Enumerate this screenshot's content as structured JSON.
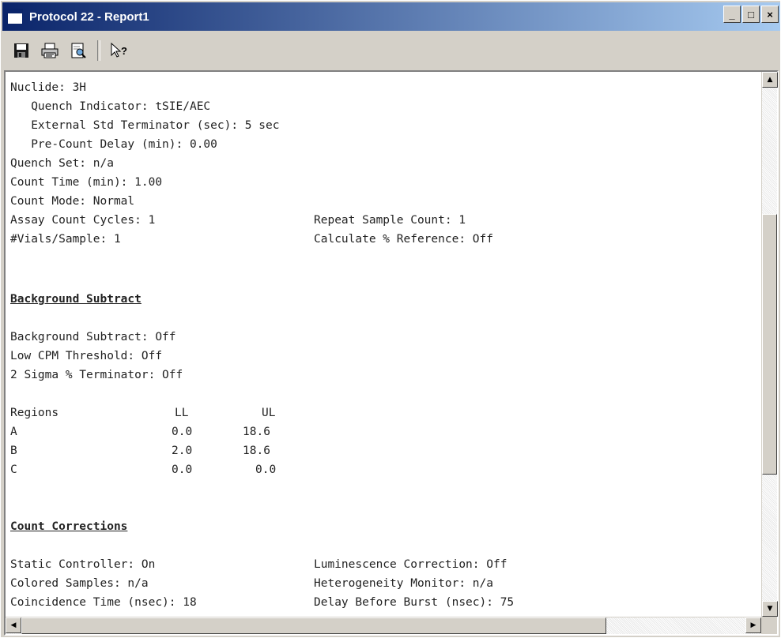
{
  "window": {
    "title": "Protocol 22 - Report1",
    "controls": {
      "minimize": "_",
      "maximize": "□",
      "close": "×"
    }
  },
  "toolbar": {
    "buttons": [
      {
        "name": "save",
        "icon": "floppy-disk-icon"
      },
      {
        "name": "print",
        "icon": "printer-icon"
      },
      {
        "name": "print-preview",
        "icon": "print-preview-icon"
      },
      {
        "name": "context-help",
        "icon": "help-pointer-icon"
      }
    ]
  },
  "report": {
    "nuclide": "Nuclide: 3H",
    "quench_indicator": "   Quench Indicator: tSIE/AEC",
    "ext_std_terminator": "   External Std Terminator (sec): 5 sec",
    "pre_count_delay": "   Pre-Count Delay (min): 0.00",
    "quench_set": "Quench Set: n/a",
    "count_time": "Count Time (min): 1.00",
    "count_mode": "Count Mode: Normal",
    "assay_count_cycles": "Assay Count Cycles: 1",
    "repeat_sample_count": "Repeat Sample Count: 1",
    "vials_per_sample": "#Vials/Sample: 1",
    "calc_reference": "Calculate % Reference: Off",
    "bg_heading": "Background Subtract",
    "bg_subtract": "Background Subtract: Off",
    "low_cpm": "Low CPM Threshold: Off",
    "two_sigma": "2 Sigma % Terminator: Off",
    "regions": {
      "headers": [
        "Regions",
        "LL",
        "UL"
      ],
      "rows": [
        [
          "A",
          "0.0",
          "18.6"
        ],
        [
          "B",
          "2.0",
          "18.6"
        ],
        [
          "C",
          "0.0",
          "0.0"
        ]
      ]
    },
    "cc_heading": "Count Corrections",
    "static_controller": "Static Controller: On",
    "luminescence": "Luminescence Correction: Off",
    "colored_samples": "Colored Samples: n/a",
    "heterogeneity": "Heterogeneity Monitor: n/a",
    "coincidence_time": "Coincidence Time (nsec): 18",
    "delay_before_burst": "Delay Before Burst (nsec): 75"
  },
  "scrollbars": {
    "up": "▲",
    "down": "▼",
    "left": "◀",
    "right": "▶"
  }
}
